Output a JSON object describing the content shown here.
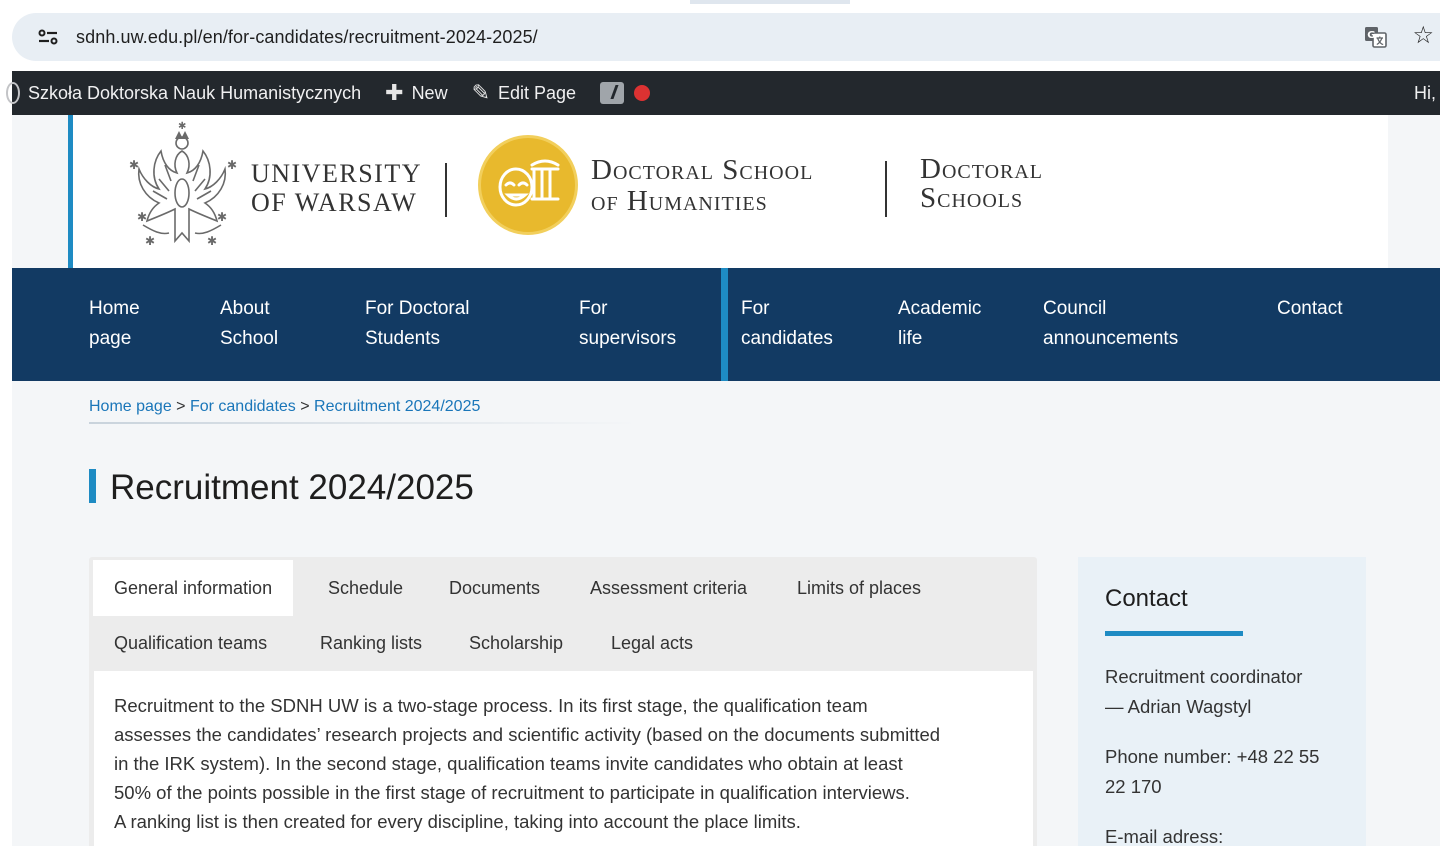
{
  "browser": {
    "url": "sdnh.uw.edu.pl/en/for-candidates/recruitment-2024-2025/"
  },
  "admin_bar": {
    "site_name": "Szkoła Doktorska Nauk Humanistycznych",
    "new_label": "New",
    "edit_label": "Edit Page",
    "greeting": "Hi,"
  },
  "header": {
    "university_line1": "UNIVERSITY",
    "university_line2": "OF WARSAW",
    "school_line1": "Doctoral School",
    "school_line2": "of Humanities",
    "schools_line1": "Doctoral",
    "schools_line2": "Schools"
  },
  "nav": {
    "items": [
      {
        "line1": "Home",
        "line2": "page"
      },
      {
        "line1": "About",
        "line2": "School"
      },
      {
        "line1": "For Doctoral",
        "line2": "Students"
      },
      {
        "line1": "For",
        "line2": "supervisors"
      },
      {
        "line1": "For",
        "line2": "candidates"
      },
      {
        "line1": "Academic",
        "line2": "life"
      },
      {
        "line1": "Council",
        "line2": "announcements"
      },
      {
        "line1": "Contact",
        "line2": ""
      }
    ]
  },
  "breadcrumb": {
    "home": "Home page",
    "sep1": " > ",
    "parent": "For candidates",
    "sep2": " > ",
    "current": "Recruitment 2024/2025"
  },
  "page": {
    "title": "Recruitment 2024/2025"
  },
  "tabs": [
    "General information",
    "Schedule",
    "Documents",
    "Assessment criteria",
    "Limits of places",
    "Qualification teams",
    "Ranking lists",
    "Scholarship",
    "Legal acts"
  ],
  "content": {
    "lines": [
      "Recruitment to the SDNH UW is a two-stage process. In its first stage, the qualification team",
      "assesses the candidates’ research projects and scientific activity (based on the documents submitted",
      "in the IRK system). In the second stage, qualification teams invite candidates who obtain at least",
      "50% of the points possible in the first stage of recruitment to participate in qualification interviews.",
      "A ranking list is then created for every discipline, taking into account the place limits."
    ]
  },
  "contact": {
    "title": "Contact",
    "coordinator_line1": "Recruitment coordinator",
    "coordinator_line2": "— Adrian Wagstyl",
    "phone_line1": "Phone number: +48 22 55",
    "phone_line2": "22 170",
    "email_label": "E-mail adress:"
  }
}
